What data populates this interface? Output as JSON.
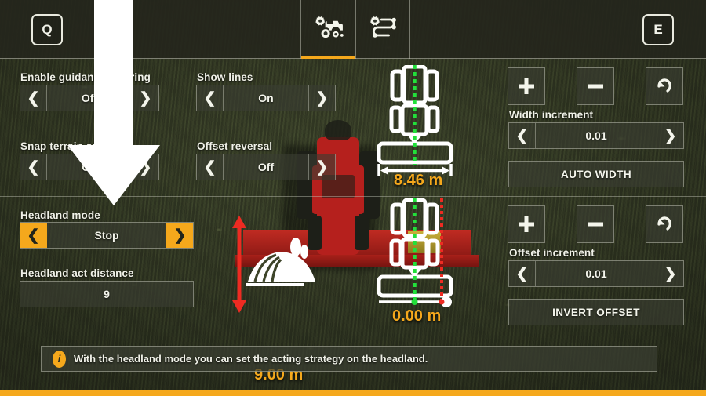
{
  "header": {
    "key_left": "Q",
    "key_right": "E",
    "tabs": [
      {
        "label": "Vehicle settings",
        "icon": "tractor-gear-icon",
        "active": true
      },
      {
        "label": "Track settings",
        "icon": "route-gear-icon",
        "active": false
      }
    ]
  },
  "settings": {
    "enable_guidance_steering": {
      "label": "Enable guidance steering",
      "value": "Off"
    },
    "snap_terrain_angle": {
      "label": "Snap terrain angle",
      "value": "On"
    },
    "show_lines": {
      "label": "Show lines",
      "value": "On"
    },
    "offset_reversal": {
      "label": "Offset reversal",
      "value": "Off"
    },
    "headland_mode": {
      "label": "Headland mode",
      "value": "Stop",
      "focused": true
    },
    "headland_act_distance": {
      "label": "Headland act distance",
      "value": "9"
    }
  },
  "width_panel": {
    "plus_label": "+",
    "minus_label": "−",
    "reset_label": "reset",
    "increment_label": "Width increment",
    "increment_value": "0.01",
    "auto_label": "AUTO WIDTH"
  },
  "offset_panel": {
    "plus_label": "+",
    "minus_label": "−",
    "reset_label": "reset",
    "increment_label": "Offset increment",
    "increment_value": "0.01",
    "invert_label": "INVERT OFFSET"
  },
  "diagrams": {
    "working_width": "8.46 m",
    "headland_distance": "9.00 m",
    "offset": "0.00 m"
  },
  "info": {
    "icon": "info-icon",
    "text": "With the headland mode you can set the acting strategy on the headland."
  },
  "colors": {
    "accent": "#f5a81c",
    "measure_green": "#22e03a",
    "measure_red": "#ee2b22",
    "panel": "#3a3e32",
    "text": "#f2f3ea"
  }
}
